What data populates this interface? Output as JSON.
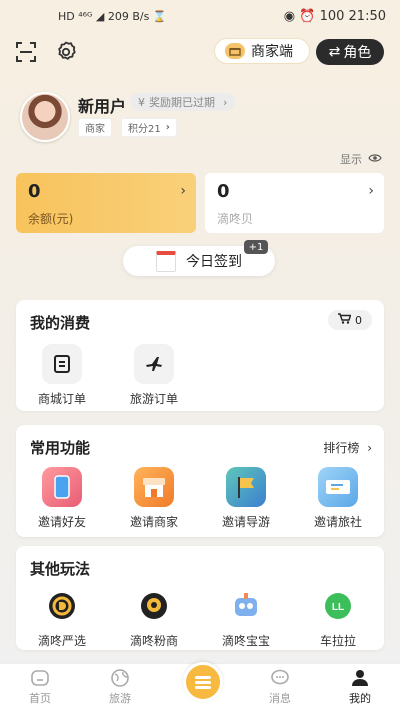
{
  "status_bar": {
    "left": "HD ⁴⁶ᴳ ◢ 209 B/s ⌛",
    "right": "◉ ⏰ 100 21:50"
  },
  "top": {
    "merchant_label": "商家端",
    "role_label": "角色",
    "role_prefix": "⇄"
  },
  "profile": {
    "name": "新用户",
    "reward": "奖励期已过期",
    "reward_icon": "¥",
    "tag_merchant": "商家",
    "tag_points": "积分21"
  },
  "show_label": "显示",
  "balance": {
    "value": "0",
    "label": "余额(元)"
  },
  "dingdong": {
    "value": "0",
    "label": "滴咚贝"
  },
  "signin": {
    "label": "今日签到",
    "bonus": "+1"
  },
  "consume": {
    "title": "我的消费",
    "cart_count": "0",
    "items": [
      "商城订单",
      "旅游订单"
    ]
  },
  "common": {
    "title": "常用功能",
    "rank_label": "排行榜",
    "items": [
      "邀请好友",
      "邀请商家",
      "邀请导游",
      "邀请旅社"
    ]
  },
  "other": {
    "title": "其他玩法",
    "items": [
      "滴咚严选",
      "滴咚粉商",
      "滴咚宝宝",
      "车拉拉"
    ]
  },
  "nav": {
    "items": [
      "首页",
      "旅游",
      "",
      "消息",
      "我的"
    ]
  },
  "colors": {
    "accent": "#f8c35c",
    "dark": "#2b2b2b"
  }
}
